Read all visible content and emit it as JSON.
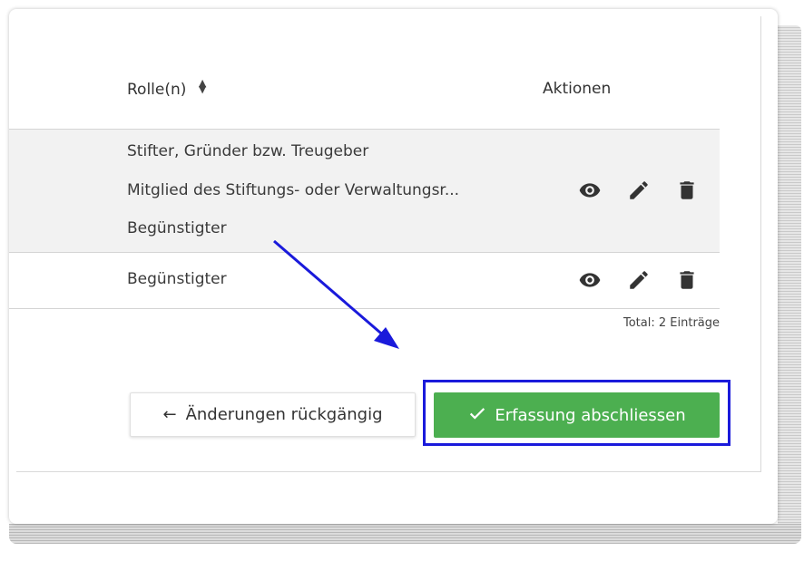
{
  "table": {
    "columns": {
      "roles": "Rolle(n)",
      "actions": "Aktionen"
    },
    "rows": [
      {
        "roles": [
          "Stifter, Gründer bzw. Treugeber",
          "Mitglied des Stiftungs- oder Verwaltungsr...",
          "Begünstigter"
        ]
      },
      {
        "roles": [
          "Begünstigter"
        ]
      }
    ],
    "total": "Total: 2 Einträge"
  },
  "buttons": {
    "undo_label": "Änderungen rückgängig",
    "finish_label": "Erfassung abschliessen"
  },
  "icons": {
    "view": "eye-icon",
    "edit": "pencil-icon",
    "delete": "trash-icon",
    "sort": "sort-icon",
    "undo": "arrow-left-icon",
    "finish": "check-icon"
  },
  "colors": {
    "finish_button": "#4caf50",
    "highlight": "#1a1adb",
    "row_highlight_bg": "#f2f2f2"
  }
}
